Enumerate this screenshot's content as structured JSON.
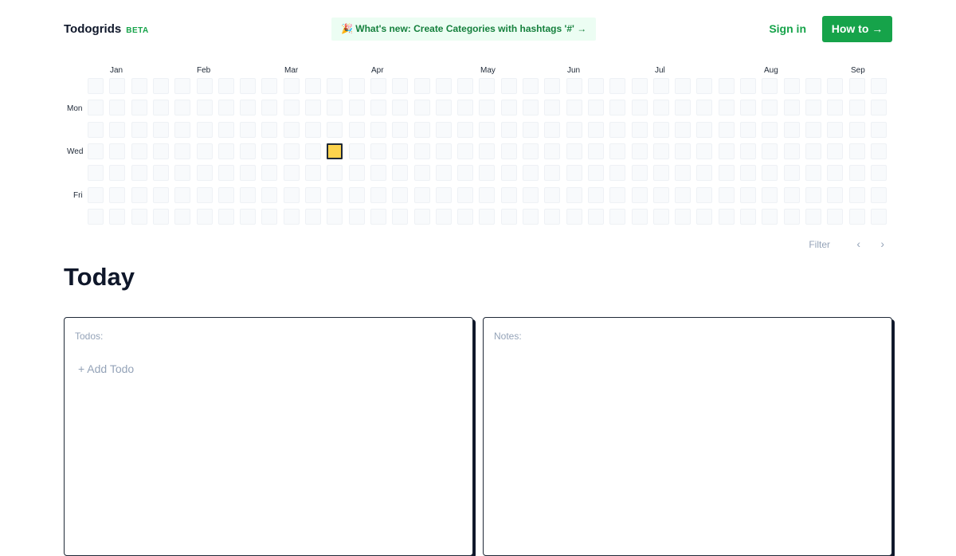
{
  "header": {
    "logo": "Todogrids",
    "badge": "BETA",
    "whats_new": "🎉 What's new: Create Categories with hashtags '#' →",
    "sign_in": "Sign in",
    "how_to": "How to →"
  },
  "grid": {
    "months": [
      "Jan",
      "Feb",
      "Mar",
      "Apr",
      "May",
      "Jun",
      "Jul",
      "Aug",
      "Sep"
    ],
    "day_labels": [
      "Mon",
      "Wed",
      "Fri"
    ],
    "weeks": 37,
    "days_per_week": 7,
    "active_cell": {
      "week": 11,
      "day": 3,
      "color": "#fcd34d"
    }
  },
  "controls": {
    "filter": "Filter",
    "prev_icon": "chevron-left-icon",
    "next_icon": "chevron-right-icon"
  },
  "today": {
    "title": "Today",
    "todos_label": "Todos:",
    "add_todo": "+ Add Todo",
    "notes_label": "Notes:"
  },
  "colors": {
    "accent": "#16a34a",
    "accent_bg": "#ecfdf3",
    "active_cell": "#fcd34d",
    "empty_cell": "#f8fafc"
  }
}
